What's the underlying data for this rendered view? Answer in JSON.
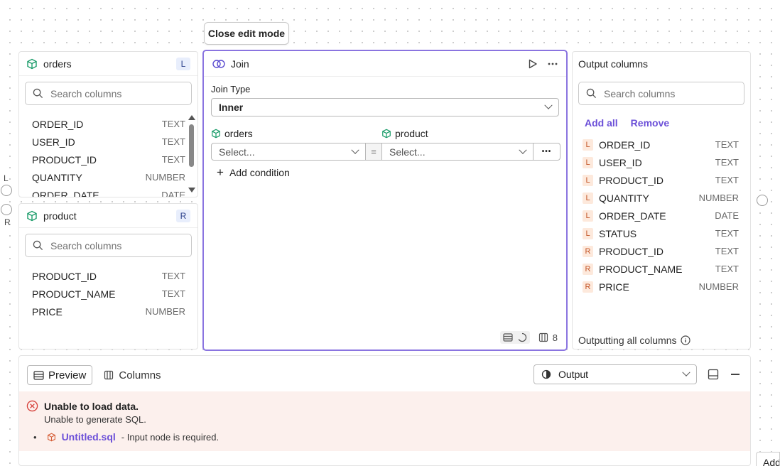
{
  "toolbar": {
    "close_edit_mode": "Close edit mode"
  },
  "handles": {
    "left": "L",
    "right": "R"
  },
  "orders_panel": {
    "title": "orders",
    "badge": "L",
    "search_placeholder": "Search columns",
    "columns": [
      {
        "name": "ORDER_ID",
        "type": "TEXT"
      },
      {
        "name": "USER_ID",
        "type": "TEXT"
      },
      {
        "name": "PRODUCT_ID",
        "type": "TEXT"
      },
      {
        "name": "QUANTITY",
        "type": "NUMBER"
      },
      {
        "name": "ORDER_DATE",
        "type": "DATE"
      }
    ]
  },
  "product_panel": {
    "title": "product",
    "badge": "R",
    "search_placeholder": "Search columns",
    "columns": [
      {
        "name": "PRODUCT_ID",
        "type": "TEXT"
      },
      {
        "name": "PRODUCT_NAME",
        "type": "TEXT"
      },
      {
        "name": "PRICE",
        "type": "NUMBER"
      }
    ]
  },
  "join_panel": {
    "title": "Join",
    "join_type_label": "Join Type",
    "join_type_value": "Inner",
    "left_table": "orders",
    "right_table": "product",
    "left_select": "Select...",
    "right_select": "Select...",
    "operator": "=",
    "more": "•••",
    "add_condition": "Add condition",
    "footer_count": "8"
  },
  "output_panel": {
    "title": "Output columns",
    "search_placeholder": "Search columns",
    "add_all": "Add all",
    "remove": "Remove",
    "columns": [
      {
        "side": "L",
        "name": "ORDER_ID",
        "type": "TEXT"
      },
      {
        "side": "L",
        "name": "USER_ID",
        "type": "TEXT"
      },
      {
        "side": "L",
        "name": "PRODUCT_ID",
        "type": "TEXT"
      },
      {
        "side": "L",
        "name": "QUANTITY",
        "type": "NUMBER"
      },
      {
        "side": "L",
        "name": "ORDER_DATE",
        "type": "DATE"
      },
      {
        "side": "L",
        "name": "STATUS",
        "type": "TEXT"
      },
      {
        "side": "R",
        "name": "PRODUCT_ID",
        "type": "TEXT"
      },
      {
        "side": "R",
        "name": "PRODUCT_NAME",
        "type": "TEXT"
      },
      {
        "side": "R",
        "name": "PRICE",
        "type": "NUMBER"
      }
    ],
    "footer": "Outputting all columns"
  },
  "bottom_panel": {
    "tab_preview": "Preview",
    "tab_columns": "Columns",
    "output_select": "Output",
    "error_title": "Unable to load data.",
    "error_sub": "Unable to generate SQL.",
    "bullet": "•",
    "error_link": "Untitled.sql",
    "error_detail": "- Input node is required."
  },
  "corner_button": "Add"
}
